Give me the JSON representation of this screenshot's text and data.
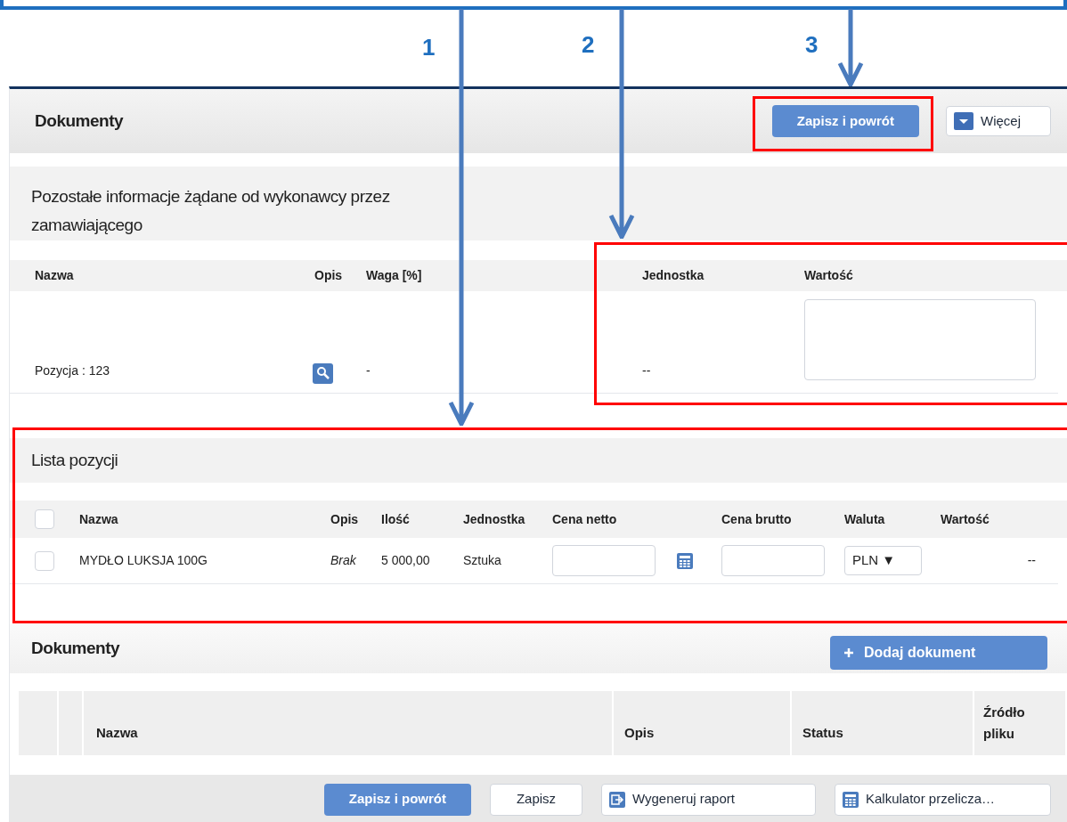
{
  "annotations": {
    "numbers": [
      "1",
      "2",
      "3"
    ]
  },
  "header": {
    "title": "Dokumenty",
    "buttons": [
      {
        "label": "Zapisz i powrót",
        "kind": "primary"
      },
      {
        "label": "Więcej",
        "kind": "dropdown"
      }
    ]
  },
  "info_section": {
    "title": "Pozostałe informacje żądane od wykonawcy przez zamawiającego",
    "columns": [
      "Nazwa",
      "Opis",
      "Waga [%]",
      "Jednostka",
      "Wartość"
    ],
    "row": {
      "name": "Pozycja : 123",
      "weight": "-",
      "unit": "--"
    }
  },
  "items": {
    "title": "Lista pozycji",
    "all_checked": false,
    "columns": [
      "Nazwa",
      "Opis",
      "Ilość",
      "Jednostka",
      "Cena netto",
      "Cena brutto",
      "Waluta",
      "Wartość"
    ],
    "rows": [
      {
        "checked": false,
        "name": "MYDŁO LUKSJA 100G",
        "description": "Brak",
        "quantity": "5 000,00",
        "unit": "Sztuka",
        "currency": "PLN ▼",
        "value": "--"
      }
    ]
  },
  "documents": {
    "title": "Dokumenty",
    "add_button": "Dodaj dokument",
    "columns": [
      "Nazwa",
      "Opis",
      "Status",
      "Źródło pliku"
    ]
  },
  "footer": {
    "buttons": [
      {
        "label": "Zapisz i powrót",
        "kind": "primary"
      },
      {
        "label": "Zapisz",
        "kind": "plain"
      },
      {
        "label": "Wygeneruj raport",
        "kind": "report"
      },
      {
        "label": "Kalkulator przelicza…",
        "kind": "calculator"
      }
    ]
  }
}
